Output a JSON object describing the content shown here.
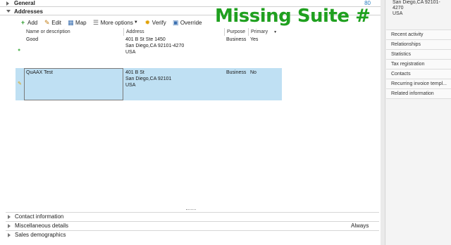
{
  "sections": {
    "general": {
      "label": "General",
      "value": "80"
    },
    "addresses": {
      "label": "Addresses"
    }
  },
  "toolbar": {
    "add": "Add",
    "edit": "Edit",
    "map": "Map",
    "more": "More options",
    "verify": "Verify",
    "override": "Override"
  },
  "grid": {
    "headers": {
      "name": "Name or description",
      "address": "Address",
      "purpose": "Purpose",
      "primary": "Primary"
    },
    "rows": [
      {
        "name": "Good",
        "addr1": "401 B St Ste 1450",
        "addr2": "San Diego,CA 92101-4270",
        "addr3": "USA",
        "purpose": "Business",
        "primary": "Yes"
      },
      {
        "name": "QuAAX Test",
        "addr1": "401 B St",
        "addr2": "San Diego,CA 92101",
        "addr3": "USA",
        "purpose": "Business",
        "primary": "No"
      }
    ]
  },
  "overlay_text": "Missing Suite #",
  "bottom_sections": {
    "contact": "Contact information",
    "misc": "Miscellaneous details",
    "misc_value": "Always",
    "sales": "Sales demographics"
  },
  "right_pane": {
    "addr_line1": "San Diego,CA 92101-4270",
    "addr_line2": "USA",
    "factbox": [
      "Recent activity",
      "Relationships",
      "Statistics",
      "Tax registration",
      "Contacts",
      "Recurring invoice templ...",
      "Related information"
    ]
  },
  "colors": {
    "accent": "#2a7fbf",
    "overlay": "#1fa01f",
    "selection": "#bfe0f3"
  }
}
